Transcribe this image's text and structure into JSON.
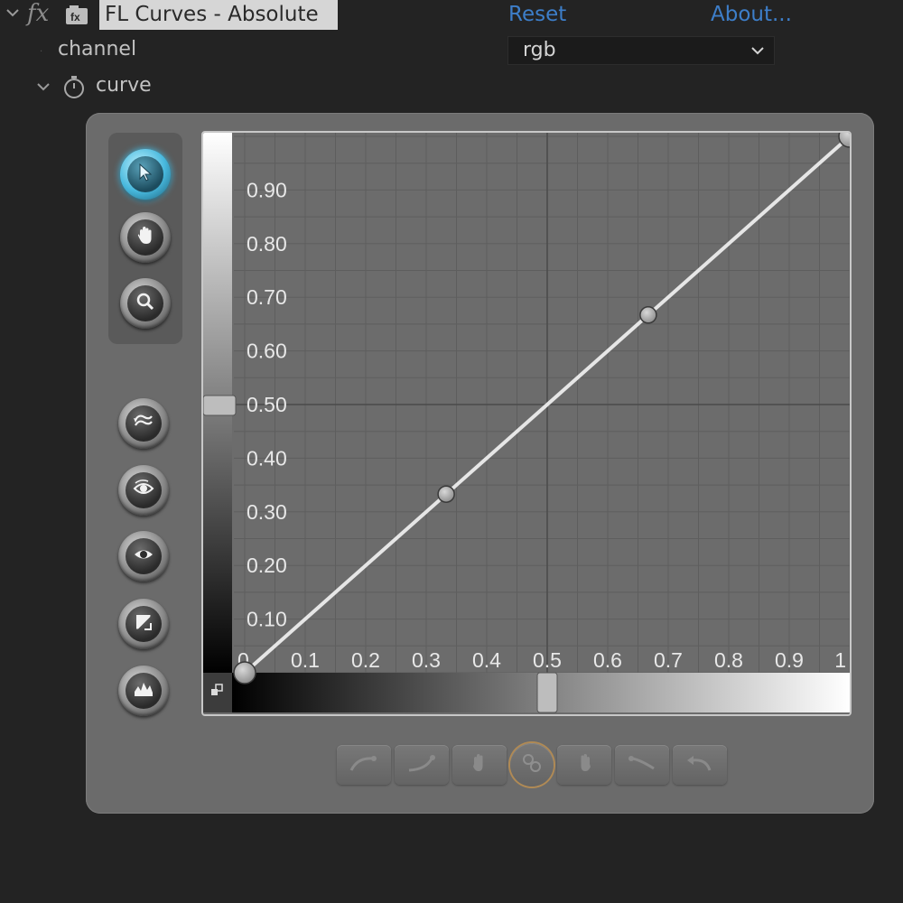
{
  "effect": {
    "title": "FL Curves - Absolute",
    "reset_label": "Reset",
    "about_label": "About...",
    "fx_label": "fx"
  },
  "properties": {
    "channel": {
      "label": "channel",
      "value": "rgb"
    },
    "curve": {
      "label": "curve"
    }
  },
  "tools": [
    "pointer-icon",
    "hand-icon",
    "zoom-icon",
    "reset-curve-icon",
    "show-original-icon",
    "view-icon",
    "invert-icon",
    "histogram-icon"
  ],
  "bottom_tools": [
    "ease-in-icon",
    "ease-out-icon",
    "hand-left-icon",
    "link-icon",
    "hand-right-icon",
    "ease-down-icon",
    "undo-icon"
  ],
  "colors": {
    "accent": "#3d7ec9",
    "active_tool": "#47b8dd",
    "grid_bg": "#6e6e6e",
    "curve": "#e6e6e6"
  },
  "chart_data": {
    "type": "line",
    "x_tick_labels": [
      "0",
      "0.1",
      "0.2",
      "0.3",
      "0.4",
      "0.5",
      "0.6",
      "0.7",
      "0.8",
      "0.9",
      "1"
    ],
    "y_tick_labels": [
      "0.10",
      "0.20",
      "0.30",
      "0.40",
      "0.50",
      "0.60",
      "0.70",
      "0.80",
      "0.90"
    ],
    "xlim": [
      0,
      1
    ],
    "ylim": [
      0,
      1
    ],
    "grid": true,
    "points": [
      {
        "x": 0.0,
        "y": 0.0
      },
      {
        "x": 0.333,
        "y": 0.333
      },
      {
        "x": 0.667,
        "y": 0.667
      },
      {
        "x": 1.0,
        "y": 1.0
      }
    ],
    "input_slider": 0.5,
    "output_slider": 0.5
  }
}
